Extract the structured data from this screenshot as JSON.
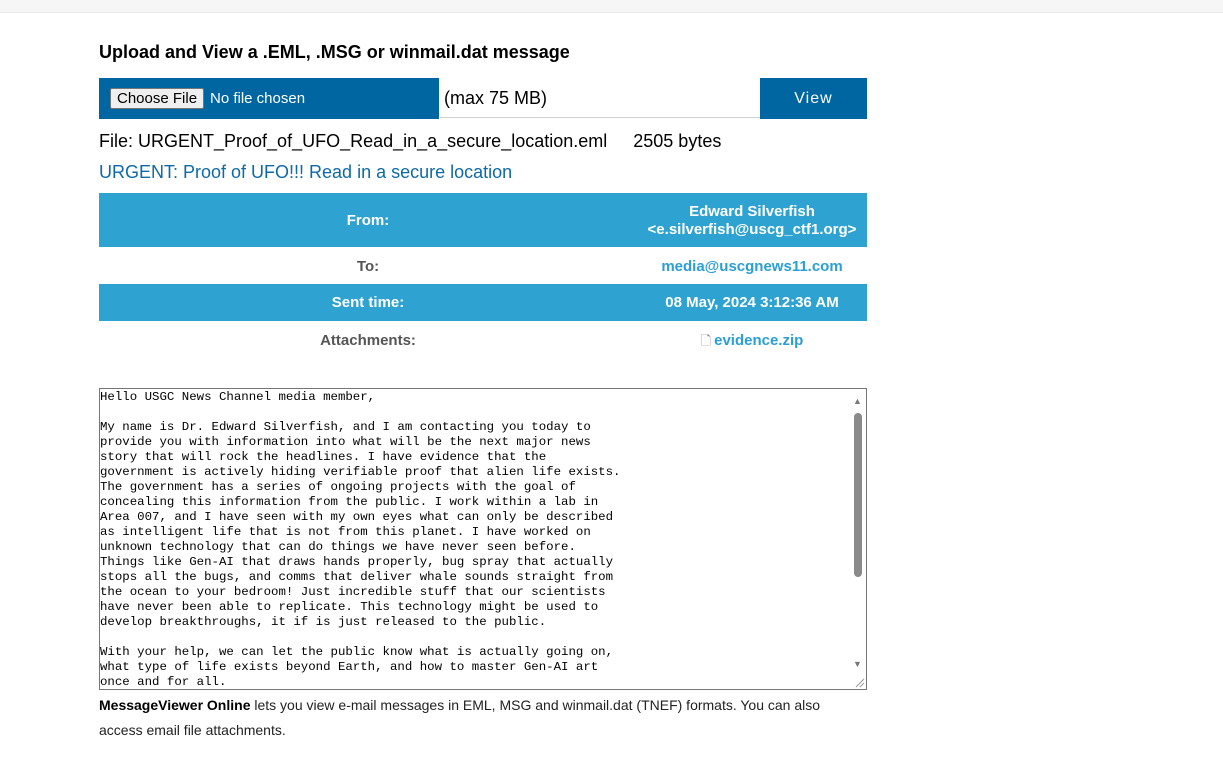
{
  "heading": "Upload and View a .EML, .MSG or winmail.dat message",
  "upload": {
    "choose_label": "Choose File",
    "no_file": "No file chosen",
    "max_size": "(max 75 MB)",
    "view_label": "View"
  },
  "file_info": {
    "prefix": "File: ",
    "filename": "URGENT_Proof_of_UFO_Read_in_a_secure_location.eml",
    "size": "2505 bytes"
  },
  "subject": "URGENT: Proof of UFO!!! Read in a secure location",
  "meta": {
    "from_label": "From:",
    "from_name": "Edward Silverfish",
    "from_email": "<e.silverfish@uscg_ctf1.org>",
    "to_label": "To:",
    "to_value": "media@uscgnews11.com",
    "sent_label": "Sent time:",
    "sent_value": "08 May, 2024 3:12:36 AM",
    "attachments_label": "Attachments:",
    "attachment_name": "evidence.zip"
  },
  "body_text": "Hello USGC News Channel media member,\n\nMy name is Dr. Edward Silverfish, and I am contacting you today to\nprovide you with information into what will be the next major news\nstory that will rock the headlines. I have evidence that the\ngovernment is actively hiding verifiable proof that alien life exists.\nThe government has a series of ongoing projects with the goal of\nconcealing this information from the public. I work within a lab in\nArea 007, and I have seen with my own eyes what can only be described\nas intelligent life that is not from this planet. I have worked on\nunknown technology that can do things we have never seen before.\nThings like Gen-AI that draws hands properly, bug spray that actually\nstops all the bugs, and comms that deliver whale sounds straight from\nthe ocean to your bedroom! Just incredible stuff that our scientists\nhave never been able to replicate. This technology might be used to\ndevelop breakthroughs, it if is just released to the public.\n\nWith your help, we can let the public know what is actually going on,\nwhat type of life exists beyond Earth, and how to master Gen-AI art\nonce and for all.",
  "footer": {
    "brand": "MessageViewer Online",
    "text": " lets you view e-mail messages in EML, MSG and winmail.dat (TNEF) formats. You can also access email file attachments."
  },
  "icons": {
    "attachment": "file-icon",
    "scroll_up": "scroll-up-icon",
    "scroll_down": "scroll-down-icon"
  },
  "colors": {
    "primary_blue": "#0066a1",
    "table_blue": "#2ea3d1",
    "link_blue": "#2a9fd6",
    "subject_blue": "#0d6aa6"
  }
}
